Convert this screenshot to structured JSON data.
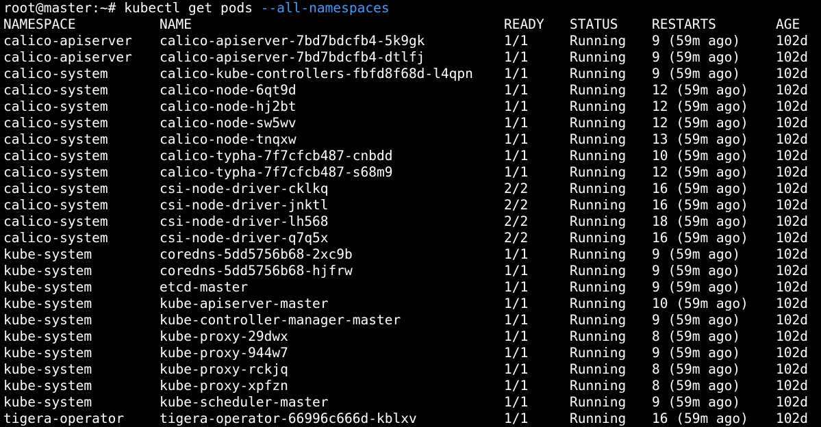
{
  "colors": {
    "background": "#000000",
    "text": "#ffffff",
    "flag": "#3b9cff"
  },
  "prompt": {
    "user_host": "root@master:~#",
    "command": "kubectl get pods",
    "flag": "--all-namespaces"
  },
  "table": {
    "headers": {
      "namespace": "NAMESPACE",
      "name": "NAME",
      "ready": "READY",
      "status": "STATUS",
      "restarts": "RESTARTS",
      "age": "AGE"
    },
    "rows": [
      {
        "namespace": "calico-apiserver",
        "name": "calico-apiserver-7bd7bdcfb4-5k9gk",
        "ready": "1/1",
        "status": "Running",
        "restarts": "9 (59m ago)",
        "age": "102d"
      },
      {
        "namespace": "calico-apiserver",
        "name": "calico-apiserver-7bd7bdcfb4-dtlfj",
        "ready": "1/1",
        "status": "Running",
        "restarts": "9 (59m ago)",
        "age": "102d"
      },
      {
        "namespace": "calico-system",
        "name": "calico-kube-controllers-fbfd8f68d-l4qpn",
        "ready": "1/1",
        "status": "Running",
        "restarts": "9 (59m ago)",
        "age": "102d"
      },
      {
        "namespace": "calico-system",
        "name": "calico-node-6qt9d",
        "ready": "1/1",
        "status": "Running",
        "restarts": "12 (59m ago)",
        "age": "102d"
      },
      {
        "namespace": "calico-system",
        "name": "calico-node-hj2bt",
        "ready": "1/1",
        "status": "Running",
        "restarts": "12 (59m ago)",
        "age": "102d"
      },
      {
        "namespace": "calico-system",
        "name": "calico-node-sw5wv",
        "ready": "1/1",
        "status": "Running",
        "restarts": "12 (59m ago)",
        "age": "102d"
      },
      {
        "namespace": "calico-system",
        "name": "calico-node-tnqxw",
        "ready": "1/1",
        "status": "Running",
        "restarts": "13 (59m ago)",
        "age": "102d"
      },
      {
        "namespace": "calico-system",
        "name": "calico-typha-7f7cfcb487-cnbdd",
        "ready": "1/1",
        "status": "Running",
        "restarts": "10 (59m ago)",
        "age": "102d"
      },
      {
        "namespace": "calico-system",
        "name": "calico-typha-7f7cfcb487-s68m9",
        "ready": "1/1",
        "status": "Running",
        "restarts": "12 (59m ago)",
        "age": "102d"
      },
      {
        "namespace": "calico-system",
        "name": "csi-node-driver-cklkq",
        "ready": "2/2",
        "status": "Running",
        "restarts": "16 (59m ago)",
        "age": "102d"
      },
      {
        "namespace": "calico-system",
        "name": "csi-node-driver-jnktl",
        "ready": "2/2",
        "status": "Running",
        "restarts": "16 (59m ago)",
        "age": "102d"
      },
      {
        "namespace": "calico-system",
        "name": "csi-node-driver-lh568",
        "ready": "2/2",
        "status": "Running",
        "restarts": "18 (59m ago)",
        "age": "102d"
      },
      {
        "namespace": "calico-system",
        "name": "csi-node-driver-q7q5x",
        "ready": "2/2",
        "status": "Running",
        "restarts": "16 (59m ago)",
        "age": "102d"
      },
      {
        "namespace": "kube-system",
        "name": "coredns-5dd5756b68-2xc9b",
        "ready": "1/1",
        "status": "Running",
        "restarts": "9 (59m ago)",
        "age": "102d"
      },
      {
        "namespace": "kube-system",
        "name": "coredns-5dd5756b68-hjfrw",
        "ready": "1/1",
        "status": "Running",
        "restarts": "9 (59m ago)",
        "age": "102d"
      },
      {
        "namespace": "kube-system",
        "name": "etcd-master",
        "ready": "1/1",
        "status": "Running",
        "restarts": "9 (59m ago)",
        "age": "102d"
      },
      {
        "namespace": "kube-system",
        "name": "kube-apiserver-master",
        "ready": "1/1",
        "status": "Running",
        "restarts": "10 (59m ago)",
        "age": "102d"
      },
      {
        "namespace": "kube-system",
        "name": "kube-controller-manager-master",
        "ready": "1/1",
        "status": "Running",
        "restarts": "9 (59m ago)",
        "age": "102d"
      },
      {
        "namespace": "kube-system",
        "name": "kube-proxy-29dwx",
        "ready": "1/1",
        "status": "Running",
        "restarts": "8 (59m ago)",
        "age": "102d"
      },
      {
        "namespace": "kube-system",
        "name": "kube-proxy-944w7",
        "ready": "1/1",
        "status": "Running",
        "restarts": "9 (59m ago)",
        "age": "102d"
      },
      {
        "namespace": "kube-system",
        "name": "kube-proxy-rckjq",
        "ready": "1/1",
        "status": "Running",
        "restarts": "8 (59m ago)",
        "age": "102d"
      },
      {
        "namespace": "kube-system",
        "name": "kube-proxy-xpfzn",
        "ready": "1/1",
        "status": "Running",
        "restarts": "8 (59m ago)",
        "age": "102d"
      },
      {
        "namespace": "kube-system",
        "name": "kube-scheduler-master",
        "ready": "1/1",
        "status": "Running",
        "restarts": "9 (59m ago)",
        "age": "102d"
      },
      {
        "namespace": "tigera-operator",
        "name": "tigera-operator-66996c666d-kblxv",
        "ready": "1/1",
        "status": "Running",
        "restarts": "16 (59m ago)",
        "age": "102d"
      }
    ]
  }
}
